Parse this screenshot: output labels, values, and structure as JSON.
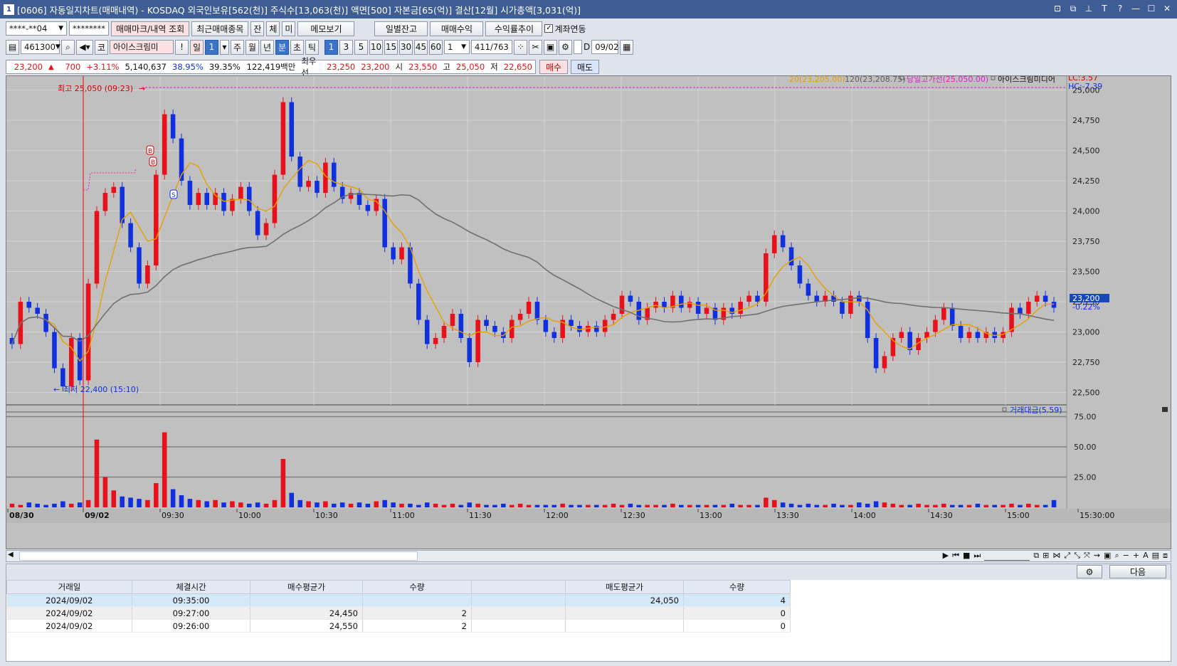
{
  "title": "[0606] 자동일지차트(매매내역) - KOSDAQ 외국인보유[562(천)] 주식수[13,063(천)] 액면[500] 자본금[65(억)] 결산[12월] 시가총액[3,031(억)]",
  "window_num": "1",
  "toolbar1": {
    "account": "****-**04",
    "password": "********",
    "btn_markers": "매매마크/내역 조회",
    "btn_recent": "최근매매종목",
    "btn_jan": "잔",
    "btn_che": "체",
    "btn_mi": "미",
    "btn_memo": "메모보기",
    "btn_daily": "일별잔고",
    "btn_trade_profit": "매매수익",
    "btn_return": "수익률추이",
    "chk_link": "계좌연동"
  },
  "toolbar2": {
    "code": "461300",
    "market": "코",
    "stock": "아이스크림미",
    "exclaim": "!",
    "day": "일",
    "period_1": "1",
    "week": "주",
    "month": "월",
    "year": "년",
    "minute": "분",
    "sec": "초",
    "tick": "틱",
    "intervals": [
      "1",
      "3",
      "5",
      "10",
      "15",
      "30",
      "45",
      "60"
    ],
    "count": "1",
    "pos": "411",
    "total": "/763",
    "d_label": "D",
    "date": "09/02"
  },
  "quote": {
    "price": "23,200",
    "change": "700",
    "pct": "+3.11%",
    "volume": "5,140,637",
    "r1": "38.95%",
    "r2": "39.35%",
    "amount": "122,419백만",
    "pref": "최우선",
    "ask": "23,250",
    "bid": "23,200",
    "open_l": "시",
    "open": "23,550",
    "high_l": "고",
    "high": "25,050",
    "low_l": "저",
    "low": "22,650",
    "buy": "매수",
    "sell": "매도"
  },
  "chart_data": {
    "type": "candlestick",
    "legend": {
      "ma20": "20(23,205.00)",
      "ma120": "120(23,208.75)",
      "highline": "당일고가선(25,050.00)",
      "name": "아이스크림미디어",
      "lc": "LC:3.57",
      "hc": "HC:-7.39"
    },
    "annotations": {
      "high": "최고 25,050 (09:23)",
      "low": "최저 22,400 (15:10)",
      "buy_marker": "B",
      "sell_marker": "S",
      "price_tag": "23,200",
      "pct_tag": "-0.22%"
    },
    "price_ticks": [
      "25,000",
      "24,750",
      "24,500",
      "24,250",
      "24,000",
      "23,750",
      "23,500",
      "23,250",
      "23,000",
      "22,750",
      "22,500"
    ],
    "price_tick_values": [
      25000,
      24750,
      24500,
      24250,
      24000,
      23750,
      23500,
      23250,
      23000,
      22750,
      22500
    ],
    "ylim": [
      22350,
      25080
    ],
    "volume_label": "거래대금(5.59)",
    "volume_ticks": [
      "75.00",
      "50.00",
      "25.00"
    ],
    "volume_tick_values": [
      75,
      50,
      25
    ],
    "volume_ylim": [
      0,
      80
    ],
    "time_labels": [
      "08/30",
      "09/02",
      "09:30",
      "10:00",
      "10:30",
      "11:00",
      "11:30",
      "12:00",
      "12:30",
      "13:00",
      "13:30",
      "14:00",
      "14:30",
      "15:00",
      "15:30:00"
    ],
    "close_series": [
      22900,
      23250,
      23200,
      23150,
      23000,
      22700,
      22550,
      22950,
      22600,
      23400,
      24000,
      24150,
      24200,
      23900,
      23700,
      23400,
      23550,
      24300,
      24800,
      24600,
      24250,
      24050,
      24150,
      24050,
      24150,
      24000,
      24100,
      24200,
      24000,
      23800,
      23900,
      24300,
      24900,
      24450,
      24200,
      24250,
      24150,
      24400,
      24200,
      24100,
      24150,
      24050,
      24000,
      24100,
      23700,
      23600,
      23700,
      23400,
      23100,
      22900,
      22950,
      23050,
      23150,
      22950,
      22750,
      23100,
      23050,
      23000,
      22950,
      23100,
      23150,
      23250,
      23100,
      23000,
      22950,
      23100,
      23050,
      23000,
      23050,
      23000,
      23100,
      23150,
      23300,
      23250,
      23100,
      23200,
      23250,
      23200,
      23300,
      23200,
      23250,
      23150,
      23200,
      23100,
      23200,
      23150,
      23250,
      23300,
      23250,
      23650,
      23800,
      23700,
      23550,
      23400,
      23300,
      23250,
      23300,
      23250,
      23150,
      23300,
      23250,
      22950,
      22700,
      22800,
      22950,
      23000,
      22850,
      22950,
      23000,
      23100,
      23200,
      23050,
      22950,
      23000,
      22950,
      23000,
      22950,
      23000,
      23200,
      23150,
      23250,
      23300,
      23250,
      23200
    ],
    "volume_series": [
      3,
      2,
      4,
      3,
      2,
      3,
      5,
      3,
      4,
      6,
      56,
      25,
      14,
      9,
      8,
      7,
      6,
      20,
      62,
      15,
      10,
      7,
      6,
      5,
      6,
      4,
      5,
      4,
      3,
      4,
      3,
      6,
      40,
      12,
      6,
      5,
      4,
      5,
      3,
      4,
      3,
      4,
      3,
      5,
      6,
      4,
      3,
      3,
      2,
      4,
      3,
      2,
      3,
      2,
      4,
      3,
      2,
      2,
      3,
      2,
      3,
      2,
      2,
      2,
      2,
      3,
      2,
      2,
      2,
      2,
      2,
      3,
      2,
      3,
      2,
      2,
      2,
      2,
      3,
      2,
      2,
      2,
      2,
      2,
      2,
      3,
      2,
      2,
      2,
      8,
      6,
      4,
      3,
      2,
      3,
      2,
      2,
      3,
      2,
      2,
      4,
      3,
      5,
      4,
      3,
      2,
      2,
      3,
      2,
      2,
      3,
      2,
      2,
      2,
      3,
      2,
      2,
      2,
      3,
      2,
      3,
      2,
      2,
      6
    ]
  },
  "trade_table": {
    "headers": [
      "거래일",
      "체결시간",
      "매수평균가",
      "수량",
      "",
      "매도평균가",
      "수량"
    ],
    "rows": [
      [
        "2024/09/02",
        "09:35:00",
        "",
        "",
        "",
        "24,050",
        "4"
      ],
      [
        "2024/09/02",
        "09:27:00",
        "24,450",
        "2",
        "",
        "",
        "0"
      ],
      [
        "2024/09/02",
        "09:26:00",
        "24,550",
        "2",
        "",
        "",
        "0"
      ]
    ],
    "next_btn": "다음"
  },
  "colors": {
    "up": "#e8101a",
    "down": "#1030e0",
    "ma20": "#e8a000",
    "ma120": "#707070",
    "highline": "#e020d0"
  }
}
